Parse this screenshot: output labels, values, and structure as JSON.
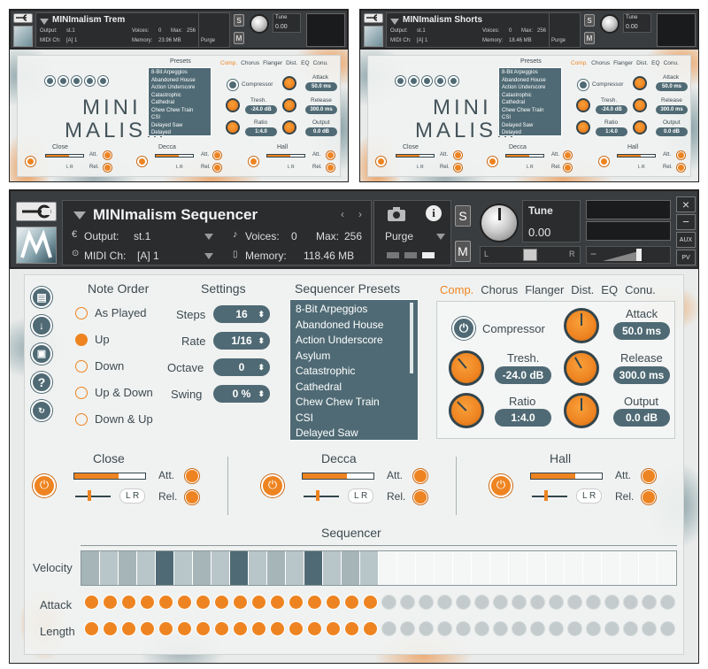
{
  "top_left": {
    "title": "MINImalism Trem",
    "output_label": "Output:",
    "output_value": "st.1",
    "voices_label": "Voices:",
    "voices_value": "0",
    "max_label": "Max:",
    "max_value": "256",
    "midi_label": "MIDI Ch:",
    "midi_value": "[A] 1",
    "memory_label": "Memory:",
    "memory_value": "23.96 MB",
    "purge_label": "Purge",
    "tune_label": "Tune",
    "tune_value": "0.00"
  },
  "top_right": {
    "title": "MINImalism Shorts",
    "output_label": "Output:",
    "output_value": "st.1",
    "voices_label": "Voices:",
    "voices_value": "0",
    "max_label": "Max:",
    "max_value": "256",
    "midi_label": "MIDI Ch:",
    "midi_value": "[A] 1",
    "memory_label": "Memory:",
    "memory_value": "18.46 MB",
    "purge_label": "Purge",
    "tune_label": "Tune",
    "tune_value": "0.00"
  },
  "small_panel": {
    "presets_label": "Presets",
    "logo_top": "MINI",
    "logo_bottom": "MALISM",
    "presets": [
      "8-Bit Arpeggios",
      "Abandoned House",
      "Action Underscore",
      "Catastrophic",
      "Cathedral",
      "Chew Chew Train",
      "CSI",
      "Delayed Saw",
      "Delayed"
    ],
    "tabs": [
      "Comp.",
      "Chorus",
      "Flanger",
      "Dist.",
      "EQ",
      "Conu."
    ],
    "compressor_label": "Compressor",
    "attack_label": "Attack",
    "attack_value": "50.0 ms",
    "thresh_label": "Tresh.",
    "thresh_value": "-24.0 dB",
    "release_label": "Release",
    "release_value": "300.0 ms",
    "ratio_label": "Ratio",
    "ratio_value": "1:4.0",
    "output_label": "Output",
    "output_value": "0.0 dB",
    "close_label": "Close",
    "decca_label": "Decca",
    "hall_label": "Hall",
    "att_label": "Att.",
    "rel_label": "Rel.",
    "lr_label": "L R"
  },
  "main": {
    "header": {
      "title": "MINImalism Sequencer",
      "output_label": "Output:",
      "output_value": "st.1",
      "voices_label": "Voices:",
      "voices_value": "0",
      "max_label": "Max:",
      "max_value": "256",
      "midi_label": "MIDI Ch:",
      "midi_value": "[A] 1",
      "memory_label": "Memory:",
      "memory_value": "118.46 MB",
      "purge_label": "Purge",
      "s_label": "S",
      "m_label": "M",
      "tune_label": "Tune",
      "tune_value": "0.00",
      "pan_l": "L",
      "pan_r": "R",
      "aux_label": "AUX",
      "pv_label": "PV",
      "close_x": "×",
      "minus": "−"
    },
    "note_order": {
      "heading": "Note Order",
      "options": [
        "As Played",
        "Up",
        "Down",
        "Up & Down",
        "Down & Up"
      ],
      "selected": "Up"
    },
    "settings": {
      "heading": "Settings",
      "steps_label": "Steps",
      "steps_value": "16",
      "rate_label": "Rate",
      "rate_value": "1/16",
      "octave_label": "Octave",
      "octave_value": "0",
      "swing_label": "Swing",
      "swing_value": "0 %"
    },
    "sequencer_presets": {
      "heading": "Sequencer Presets",
      "items": [
        "8-Bit Arpeggios",
        "Abandoned House",
        "Action Underscore",
        "Asylum",
        "Catastrophic",
        "Cathedral",
        "Chew Chew Train",
        "CSI",
        "Delayed Saw"
      ]
    },
    "effects": {
      "tabs": [
        "Comp.",
        "Chorus",
        "Flanger",
        "Dist.",
        "EQ",
        "Conu."
      ],
      "active_tab": "Comp.",
      "compressor_label": "Compressor",
      "attack_label": "Attack",
      "attack_value": "50.0 ms",
      "thresh_label": "Tresh.",
      "thresh_value": "-24.0 dB",
      "release_label": "Release",
      "release_value": "300.0 ms",
      "ratio_label": "Ratio",
      "ratio_value": "1:4.0",
      "output_label": "Output",
      "output_value": "0.0 dB"
    },
    "mics": [
      {
        "name": "Close",
        "att_label": "Att.",
        "rel_label": "Rel.",
        "lr_label": "L R",
        "level": 0.62
      },
      {
        "name": "Decca",
        "att_label": "Att.",
        "rel_label": "Rel.",
        "lr_label": "L R",
        "level": 0.62
      },
      {
        "name": "Hall",
        "att_label": "Att.",
        "rel_label": "Rel.",
        "lr_label": "L R",
        "level": 0.62
      }
    ],
    "sequencer": {
      "heading": "Sequencer",
      "velocity_label": "Velocity",
      "attack_label": "Attack",
      "length_label": "Length",
      "steps_active": 16,
      "steps_total": 32,
      "velocity_accents": [
        5,
        9,
        13
      ]
    },
    "colors": {
      "accent": "#ee8421",
      "slate": "#4f6a74",
      "panel": "#e9ebea"
    }
  }
}
